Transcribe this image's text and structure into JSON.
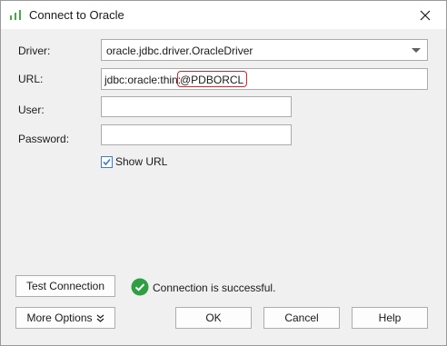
{
  "window": {
    "title": "Connect to Oracle",
    "icon": "bar-chart-icon",
    "close_icon": "close-icon"
  },
  "form": {
    "driver_label": "Driver:",
    "driver_value": "oracle.jdbc.driver.OracleDriver",
    "url_label": "URL:",
    "url_prefix": "jdbc:oracle:thin:",
    "url_highlight": "@PDBORCL",
    "user_label": "User:",
    "user_value": "",
    "password_label": "Password:",
    "password_value": "",
    "show_url_label": "Show URL",
    "show_url_checked": true
  },
  "status": {
    "text": "Connection is successful.",
    "icon": "success-check-icon",
    "color": "#2ea043"
  },
  "buttons": {
    "test_connection": "Test Connection",
    "more_options": "More Options",
    "more_options_icon": "double-chevron-down-icon",
    "ok": "OK",
    "cancel": "Cancel",
    "help": "Help"
  },
  "colors": {
    "highlight_border": "#d9252b",
    "accent": "#3a7ed6"
  }
}
